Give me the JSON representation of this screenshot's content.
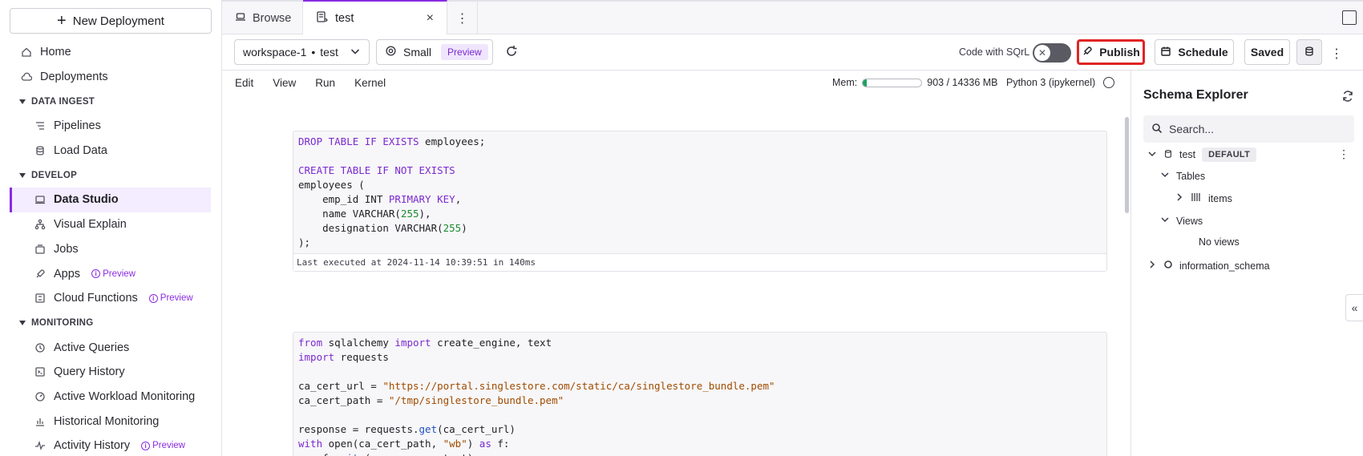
{
  "sidebar": {
    "new_deployment": "New Deployment",
    "items": [
      {
        "label": "Home"
      },
      {
        "label": "Deployments"
      }
    ],
    "sections": [
      {
        "title": "DATA INGEST",
        "items": [
          {
            "label": "Pipelines"
          },
          {
            "label": "Load Data"
          }
        ]
      },
      {
        "title": "DEVELOP",
        "items": [
          {
            "label": "Data Studio"
          },
          {
            "label": "Visual Explain"
          },
          {
            "label": "Jobs"
          },
          {
            "label": "Apps",
            "badge": "Preview"
          },
          {
            "label": "Cloud Functions",
            "badge": "Preview"
          }
        ]
      },
      {
        "title": "MONITORING",
        "items": [
          {
            "label": "Active Queries"
          },
          {
            "label": "Query History"
          },
          {
            "label": "Active Workload Monitoring"
          },
          {
            "label": "Historical Monitoring"
          },
          {
            "label": "Activity History",
            "badge": "Preview"
          }
        ]
      }
    ]
  },
  "tabs": {
    "browse": "Browse",
    "test": "test",
    "close": "×"
  },
  "toolbar": {
    "workspace": "workspace-1",
    "database": "test",
    "size": "Small",
    "preview": "Preview",
    "code_with_sqrl": "Code with SQrL",
    "publish": "Publish",
    "schedule": "Schedule",
    "saved": "Saved"
  },
  "menubar": {
    "menus": [
      "Edit",
      "View",
      "Run",
      "Kernel"
    ],
    "mem_label": "Mem:",
    "mem_value": "903 / 14336 MB",
    "mem_fraction": 0.063,
    "kernel": "Python 3 (ipykernel)"
  },
  "cells": [
    {
      "footer": "Last executed at 2024-11-14 10:39:51 in 140ms"
    }
  ],
  "schema": {
    "title": "Schema Explorer",
    "search_placeholder": "Search...",
    "db": "test",
    "default": "DEFAULT",
    "tables": "Tables",
    "table_items": "items",
    "views": "Views",
    "no_views": "No views",
    "info_schema": "information_schema"
  },
  "colors": {
    "accent": "#8a2be2",
    "highlight": "#e02424",
    "mem_fill": "#1aa260"
  }
}
